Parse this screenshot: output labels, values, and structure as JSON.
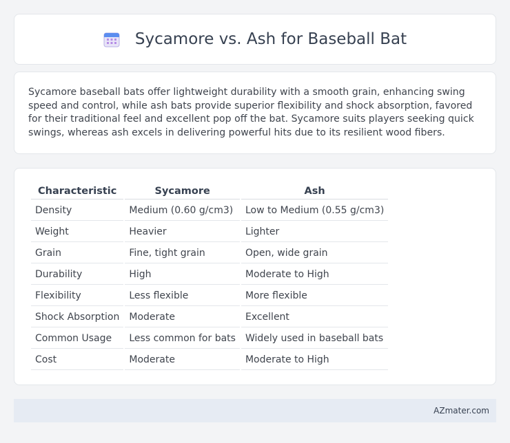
{
  "title": "Sycamore vs. Ash for Baseball Bat",
  "description": "Sycamore baseball bats offer lightweight durability with a smooth grain, enhancing swing speed and control, while ash bats provide superior flexibility and shock absorption, favored for their traditional feel and excellent pop off the bat. Sycamore suits players seeking quick swings, whereas ash excels in delivering powerful hits due to its resilient wood fibers.",
  "table": {
    "headers": [
      "Characteristic",
      "Sycamore",
      "Ash"
    ],
    "rows": [
      [
        "Density",
        "Medium (0.60 g/cm3)",
        "Low to Medium (0.55 g/cm3)"
      ],
      [
        "Weight",
        "Heavier",
        "Lighter"
      ],
      [
        "Grain",
        "Fine, tight grain",
        "Open, wide grain"
      ],
      [
        "Durability",
        "High",
        "Moderate to High"
      ],
      [
        "Flexibility",
        "Less flexible",
        "More flexible"
      ],
      [
        "Shock Absorption",
        "Moderate",
        "Excellent"
      ],
      [
        "Common Usage",
        "Less common for bats",
        "Widely used in baseball bats"
      ],
      [
        "Cost",
        "Moderate",
        "Moderate to High"
      ]
    ]
  },
  "footer": {
    "brand": "AZmater.com"
  },
  "icon": "calendar-icon"
}
